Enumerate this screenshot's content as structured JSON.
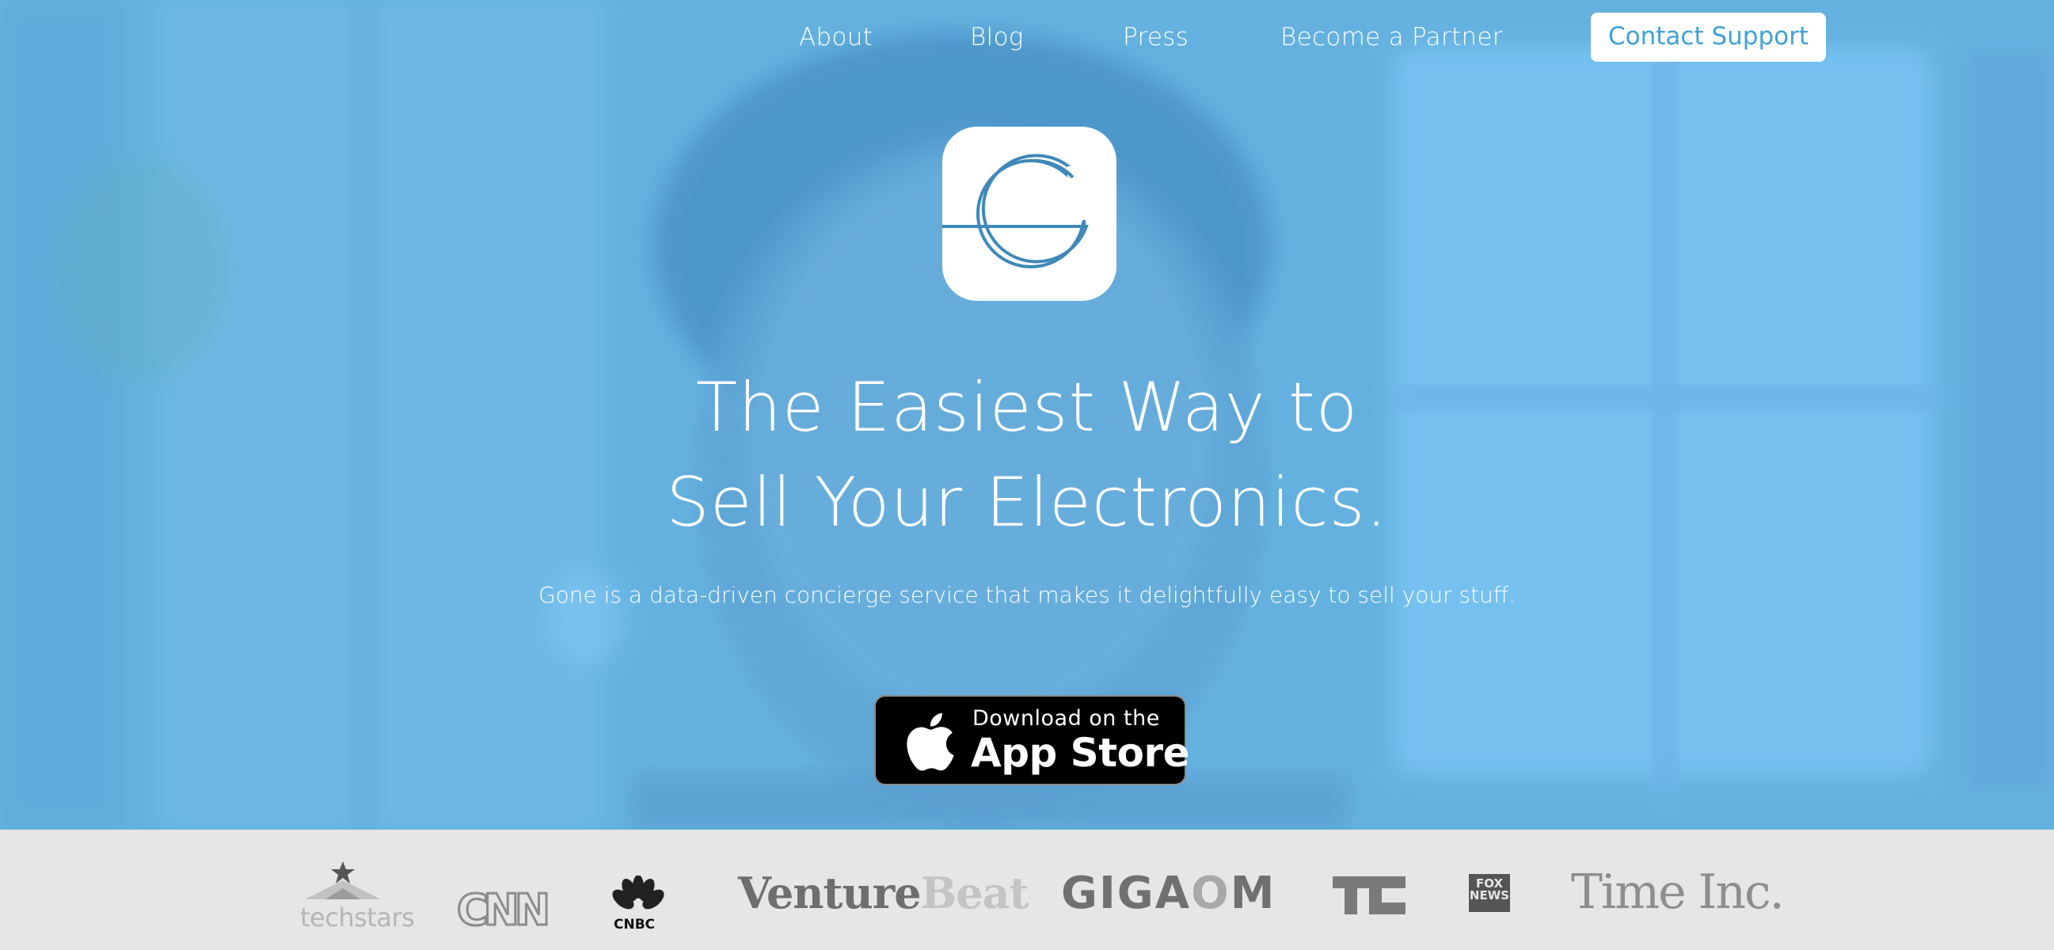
{
  "nav": {
    "links": [
      "About",
      "Blog",
      "Press",
      "Become a Partner"
    ],
    "cta": "Contact Support"
  },
  "logo": {
    "icon": "gone-g-logo-icon"
  },
  "hero": {
    "headline_line1": "The Easiest Way to",
    "headline_line2": "Sell Your Electronics.",
    "subtitle": "Gone is a data-driven concierge service that makes it delightfully easy to sell your stuff."
  },
  "app_store": {
    "line1": "Download on the",
    "line2": "App Store",
    "icon": "apple-icon"
  },
  "press": {
    "logos": [
      {
        "name": "techstars",
        "text": "techstars"
      },
      {
        "name": "cnn",
        "text": "CNN"
      },
      {
        "name": "cnbc",
        "text": "CNBC"
      },
      {
        "name": "venturebeat",
        "text_a": "Venture",
        "text_b": "Beat"
      },
      {
        "name": "gigaom",
        "text_a": "GIGA",
        "text_b": "O",
        "text_c": "M"
      },
      {
        "name": "techcrunch",
        "text": "TC"
      },
      {
        "name": "fox-news",
        "text_a": "FOX",
        "text_b": "NEWS"
      },
      {
        "name": "time-inc",
        "text": "Time Inc."
      }
    ]
  },
  "colors": {
    "hero_blue": "#65b3df",
    "press_bar": "#e6e6e6",
    "accent": "#3ea1d9",
    "logo_stroke": "#3f88b9"
  }
}
